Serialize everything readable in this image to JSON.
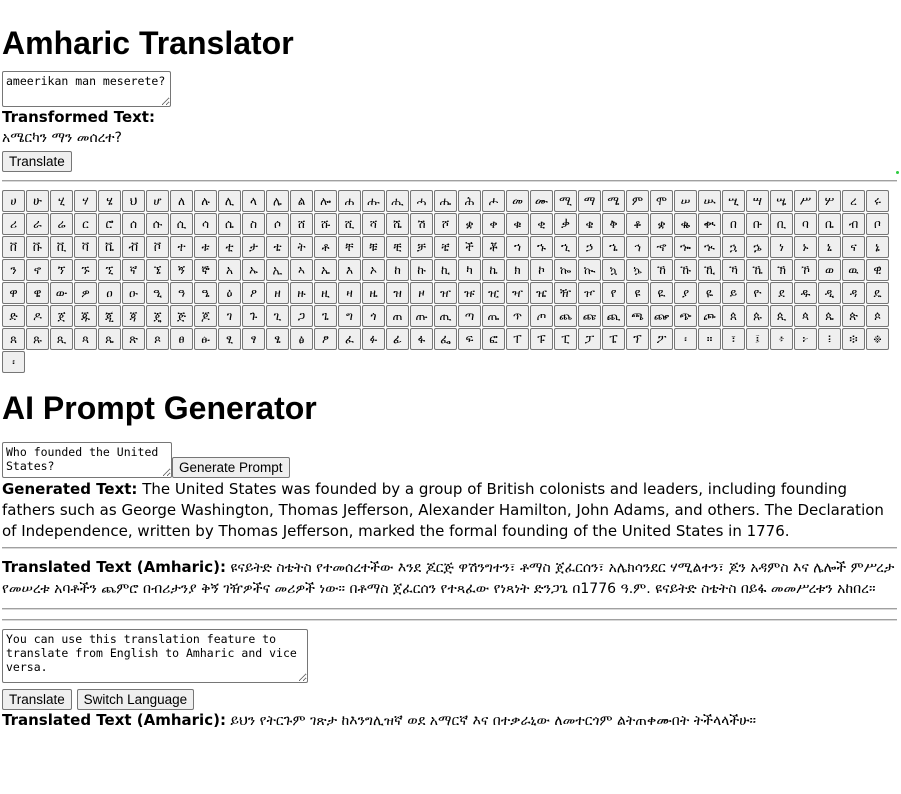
{
  "translator": {
    "title": "Amharic Translator",
    "input_value": "ameerikan man meserete?",
    "transformed_label": "Transformed Text:",
    "transformed_value": "አሜርካን ማን መሰረተ?",
    "translate_button": "Translate"
  },
  "keyboard": {
    "keys": [
      "ሀ",
      "ሁ",
      "ሂ",
      "ሃ",
      "ሄ",
      "ህ",
      "ሆ",
      "ለ",
      "ሉ",
      "ሊ",
      "ላ",
      "ሌ",
      "ል",
      "ሎ",
      "ሐ",
      "ሑ",
      "ሒ",
      "ሓ",
      "ሔ",
      "ሕ",
      "ሖ",
      "መ",
      "ሙ",
      "ሚ",
      "ማ",
      "ሜ",
      "ም",
      "ሞ",
      "ሠ",
      "ሡ",
      "ሢ",
      "ሣ",
      "ሤ",
      "ሥ",
      "ሦ",
      "ረ",
      "ሩ",
      "ሪ",
      "ራ",
      "ሬ",
      "ር",
      "ሮ",
      "ሰ",
      "ሱ",
      "ሲ",
      "ሳ",
      "ሴ",
      "ስ",
      "ሶ",
      "ሸ",
      "ሹ",
      "ሺ",
      "ሻ",
      "ሼ",
      "ሽ",
      "ሾ",
      "ቋ",
      "ቀ",
      "ቁ",
      "ቂ",
      "ቃ",
      "ቄ",
      "ቅ",
      "ቆ",
      "ቋ",
      "ቈ",
      "ቊ",
      "በ",
      "ቡ",
      "ቢ",
      "ባ",
      "ቤ",
      "ብ",
      "ቦ",
      "ቨ",
      "ቩ",
      "ቪ",
      "ቫ",
      "ቬ",
      "ቭ",
      "ቮ",
      "ተ",
      "ቱ",
      "ቲ",
      "ታ",
      "ቴ",
      "ት",
      "ቶ",
      "ቸ",
      "ቹ",
      "ቺ",
      "ቻ",
      "ቼ",
      "ች",
      "ቾ",
      "ኀ",
      "ኁ",
      "ኂ",
      "ኃ",
      "ኄ",
      "ኅ",
      "ኆ",
      "ኈ",
      "ኊ",
      "ኋ",
      "ኌ",
      "ነ",
      "ኑ",
      "ኒ",
      "ና",
      "ኔ",
      "ን",
      "ኖ",
      "ኘ",
      "ኙ",
      "ኚ",
      "ኛ",
      "ኜ",
      "ኝ",
      "ኞ",
      "አ",
      "ኡ",
      "ኢ",
      "ኣ",
      "ኤ",
      "እ",
      "ኦ",
      "ከ",
      "ኩ",
      "ኪ",
      "ካ",
      "ኬ",
      "ክ",
      "ኮ",
      "ኰ",
      "ኲ",
      "ኳ",
      "ኴ",
      "ኸ",
      "ኹ",
      "ኺ",
      "ኻ",
      "ኼ",
      "ኽ",
      "ኾ",
      "ወ",
      "ዉ",
      "ዊ",
      "ዋ",
      "ዌ",
      "ው",
      "ዎ",
      "ዐ",
      "ዑ",
      "ዒ",
      "ዓ",
      "ዔ",
      "ዕ",
      "ዖ",
      "ዘ",
      "ዙ",
      "ዚ",
      "ዛ",
      "ዜ",
      "ዝ",
      "ዞ",
      "ዠ",
      "ዡ",
      "ዢ",
      "ዣ",
      "ዤ",
      "ዥ",
      "ዦ",
      "የ",
      "ዩ",
      "ዪ",
      "ያ",
      "ዬ",
      "ይ",
      "ዮ",
      "ደ",
      "ዱ",
      "ዲ",
      "ዳ",
      "ዴ",
      "ድ",
      "ዶ",
      "ጀ",
      "ጁ",
      "ጂ",
      "ጃ",
      "ጄ",
      "ጅ",
      "ጆ",
      "ገ",
      "ጉ",
      "ጊ",
      "ጋ",
      "ጌ",
      "ግ",
      "ጎ",
      "ጠ",
      "ጡ",
      "ጢ",
      "ጣ",
      "ጤ",
      "ጥ",
      "ጦ",
      "ጨ",
      "ጩ",
      "ጪ",
      "ጫ",
      "ጬ",
      "ጭ",
      "ጮ",
      "ጰ",
      "ጱ",
      "ጲ",
      "ጳ",
      "ጴ",
      "ጵ",
      "ጶ",
      "ጸ",
      "ጹ",
      "ጺ",
      "ጻ",
      "ጼ",
      "ጽ",
      "ጾ",
      "ፀ",
      "ፁ",
      "ፂ",
      "ፃ",
      "ፄ",
      "ፅ",
      "ፆ",
      "ፈ",
      "ፉ",
      "ፊ",
      "ፋ",
      "ፌ",
      "ፍ",
      "ፎ",
      "ፐ",
      "ፑ",
      "ፒ",
      "ፓ",
      "ፔ",
      "ፕ",
      "ፖ",
      "፡",
      "።",
      "፣",
      "፤",
      "፥",
      "፦",
      "፧",
      "፨",
      "፠",
      "፡"
    ]
  },
  "generator": {
    "title": "AI Prompt Generator",
    "input_value": "Who founded the United States?",
    "generate_button": "Generate Prompt",
    "generated_label": "Generated Text:",
    "generated_value": "The United States was founded by a group of British colonists and leaders, including founding fathers such as George Washington, Thomas Jefferson, Alexander Hamilton, John Adams, and others. The Declaration of Independence, written by Thomas Jefferson, marked the formal founding of the United States in 1776.",
    "translated_label": "Translated Text (Amharic):",
    "translated_value": "ዩናይትድ ስቴትስ የተመሰረተችው እንደ ጆርጅ ዋሽንግተን፣ ቶማስ ጀፈርሰን፣ አሌክሳንደር ሃሚልተን፣ ጆን አዳምስ እና ሌሎች ምሥረታ የመሠረቱ አባቶችን ጨምሮ በብሪታንያ ቅኝ ገዥዎችና መሪዎች ነው። በቶማስ ጀፈርሰን የተጻፈው የነጻነት ድንጋጌ በ1776 ዓ.ም. ዩናይትድ ስቴትስ በይፋ መመሥረቱን አከበረ።"
  },
  "bidirectional": {
    "input_value": "You can use this translation feature to translate from English to Amharic and vice versa.",
    "translate_button": "Translate",
    "switch_button": "Switch Language",
    "translated_label": "Translated Text (Amharic):",
    "translated_value": "ይህን የትርጉም ገጽታ ከእንግሊዝኛ ወደ አማርኛ እና በተቃራኒው ለመተርጎም ልትጠቀሙበት ትችላላችሁ።"
  }
}
